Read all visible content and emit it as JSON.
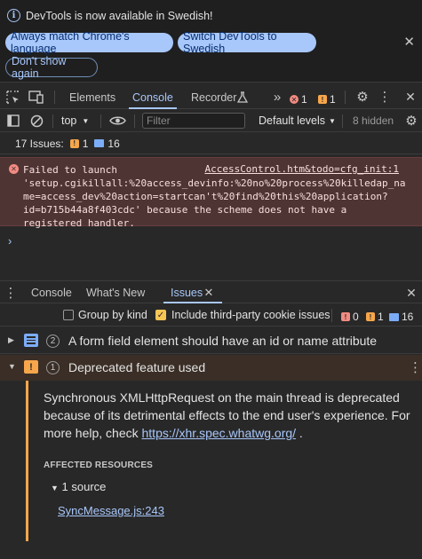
{
  "infobar": {
    "message": "DevTools is now available in Swedish!",
    "match_label": "Always match Chrome's language",
    "switch_label": "Switch DevTools to Swedish",
    "dont_show_label": "Don't show again"
  },
  "main_tabs": {
    "elements": "Elements",
    "console": "Console",
    "recorder": "Recorder",
    "error_count": "1",
    "warning_count": "1"
  },
  "console_toolbar": {
    "context": "top",
    "filter_placeholder": "Filter",
    "levels_label": "Default levels",
    "hidden_label": "8 hidden"
  },
  "issues_summary": {
    "label": "17 Issues:",
    "warning_count": "1",
    "info_count": "16"
  },
  "console_error": {
    "text": "Failed to launch\n'setup.cgikillall:%20access_devinfo:%20no%20process%20killedap_na\nme=access_dev%20action=startcan't%20find%20this%20application?\nid=b715b44a8f403cdc' because the scheme does not have a\nregistered handler.",
    "source_link": "AccessControl.htm&todo=cfg_init:1"
  },
  "drawer": {
    "tab_console": "Console",
    "tab_whats_new": "What's New",
    "tab_issues": "Issues"
  },
  "issues_toolbar": {
    "group_by_kind": "Group by kind",
    "include_third_party": "Include third-party cookie issues",
    "error_count": "0",
    "warning_count": "1",
    "info_count": "16"
  },
  "issues": [
    {
      "count": "2",
      "title": "A form field element should have an id or name attribute"
    },
    {
      "count": "1",
      "title": "Deprecated feature used"
    }
  ],
  "issue_detail": {
    "text_before": "Synchronous XMLHttpRequest on the main thread is deprecated because of its detrimental effects to the end user's experience. For more help, check ",
    "link": "https://xhr.spec.whatwg.org/",
    "text_after": " .",
    "affected_label": "AFFECTED RESOURCES",
    "sources_label": "1 source",
    "source_file": "SyncMessage.js:243"
  },
  "colors": {
    "accent": "#a8c7fa",
    "error": "#f28b82",
    "warning": "#f8a64b",
    "background": "#282828"
  }
}
